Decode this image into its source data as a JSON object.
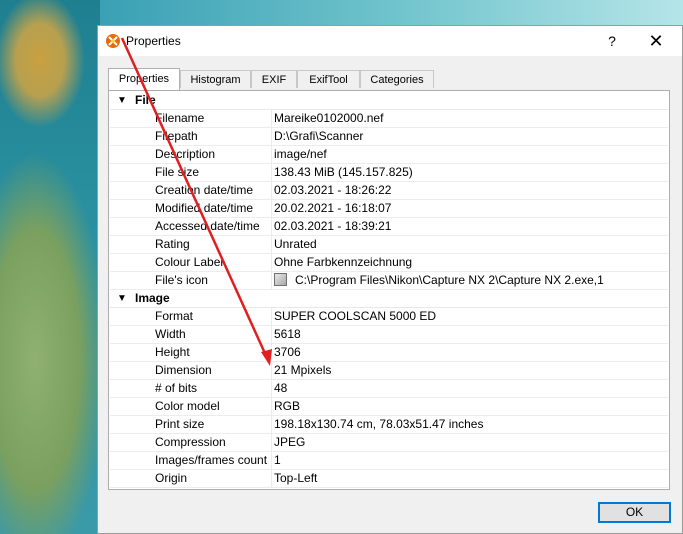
{
  "window": {
    "title": "Properties",
    "help_label": "?",
    "close_label": "✕"
  },
  "tabs": [
    {
      "label": "Properties",
      "active": true
    },
    {
      "label": "Histogram",
      "active": false
    },
    {
      "label": "EXIF",
      "active": false
    },
    {
      "label": "ExifTool",
      "active": false
    },
    {
      "label": "Categories",
      "active": false
    }
  ],
  "groups": {
    "file": {
      "label": "File",
      "expanded": true,
      "rows": [
        {
          "name": "Filename",
          "value": "Mareike0102000.nef"
        },
        {
          "name": "Filepath",
          "value": "D:\\Grafi\\Scanner"
        },
        {
          "name": "Description",
          "value": "image/nef"
        },
        {
          "name": "File size",
          "value": "138.43 MiB (145.157.825)"
        },
        {
          "name": "Creation date/time",
          "value": "02.03.2021 - 18:26:22"
        },
        {
          "name": "Modified date/time",
          "value": "20.02.2021 - 16:18:07"
        },
        {
          "name": "Accessed date/time",
          "value": "02.03.2021 - 18:39:21"
        },
        {
          "name": "Rating",
          "value": "Unrated"
        },
        {
          "name": "Colour Label",
          "value": "Ohne Farbkennzeichnung"
        },
        {
          "name": "File's icon",
          "value": "C:\\Program Files\\Nikon\\Capture NX 2\\Capture NX 2.exe,1",
          "icon": "exe-file-icon"
        }
      ]
    },
    "image": {
      "label": "Image",
      "expanded": true,
      "rows": [
        {
          "name": "Format",
          "value": "SUPER COOLSCAN 5000 ED"
        },
        {
          "name": "Width",
          "value": "5618"
        },
        {
          "name": "Height",
          "value": "3706"
        },
        {
          "name": "Dimension",
          "value": "21 Mpixels"
        },
        {
          "name": "# of bits",
          "value": "48"
        },
        {
          "name": "Color model",
          "value": "RGB"
        },
        {
          "name": "Print size",
          "value": "198.18x130.74 cm, 78.03x51.47 inches"
        },
        {
          "name": "Compression",
          "value": "JPEG"
        },
        {
          "name": "Images/frames count",
          "value": "1"
        },
        {
          "name": "Origin",
          "value": "Top-Left"
        }
      ]
    }
  },
  "buttons": {
    "ok_label": "OK"
  },
  "colors": {
    "accent": "#0078d7",
    "annotation_arrow": "#e02020"
  },
  "icons": {
    "app": "xnview-app-icon",
    "collapse": "chevron-down-icon"
  }
}
